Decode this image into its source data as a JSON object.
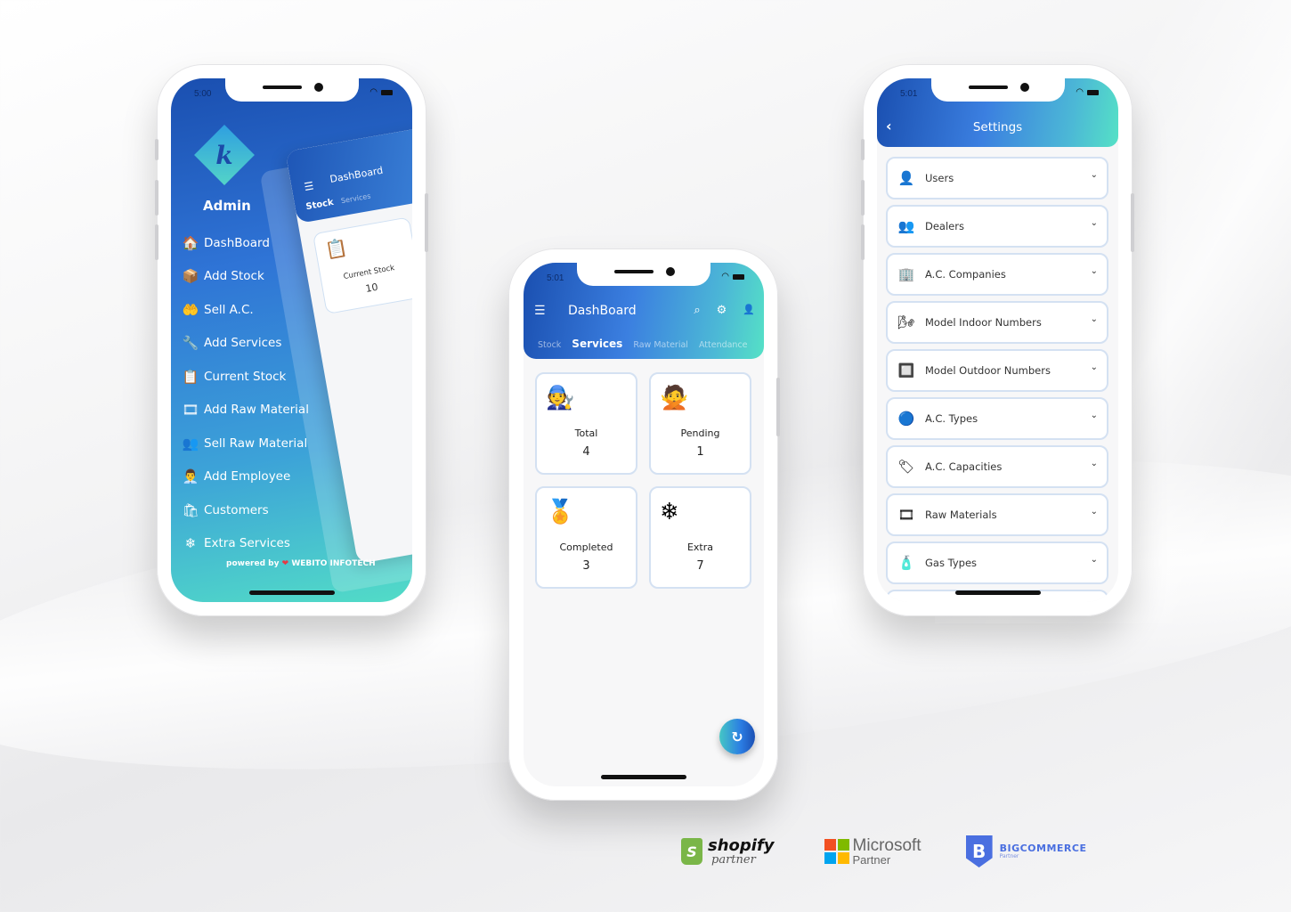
{
  "phone_admin": {
    "status_time": "5:00",
    "logo_letter": "k",
    "user_name": "Admin",
    "menu": [
      {
        "label": "DashBoard",
        "icon": "🏠"
      },
      {
        "label": "Add Stock",
        "icon": "📦"
      },
      {
        "label": "Sell A.C.",
        "icon": "🤲"
      },
      {
        "label": "Add Services",
        "icon": "🔧"
      },
      {
        "label": "Current Stock",
        "icon": "📋"
      },
      {
        "label": "Add Raw Material",
        "icon": "🎞"
      },
      {
        "label": "Sell Raw Material",
        "icon": "👥"
      },
      {
        "label": "Add Employee",
        "icon": "👨‍💼"
      },
      {
        "label": "Customers",
        "icon": "🛍"
      },
      {
        "label": "Extra Services",
        "icon": "❄"
      }
    ],
    "powered_by_prefix": "powered by",
    "powered_by_heart": "❤",
    "powered_by_company": "WEBITO INFOTECH",
    "peek": {
      "title": "DashBoard",
      "tab_active": "Stock",
      "tab_inactive": "Services",
      "card_label": "Current Stock",
      "card_value": "10",
      "card_icon": "📋"
    }
  },
  "phone_dashboard": {
    "status_time": "5:01",
    "title": "DashBoard",
    "menu_icon": "☰",
    "search_icon": "⌕",
    "gear_icon": "⚙",
    "user_icon": "👤",
    "tabs": [
      {
        "label": "Stock",
        "active": false
      },
      {
        "label": "Services",
        "active": true
      },
      {
        "label": "Raw Material",
        "active": false
      },
      {
        "label": "Attendance",
        "active": false
      }
    ],
    "cards": [
      {
        "label": "Total",
        "value": "4",
        "icon": "🧑‍🔧"
      },
      {
        "label": "Pending",
        "value": "1",
        "icon": "🙅"
      },
      {
        "label": "Completed",
        "value": "3",
        "icon": "🏅"
      },
      {
        "label": "Extra",
        "value": "7",
        "icon": "❄"
      }
    ],
    "refresh_icon": "↻"
  },
  "phone_settings": {
    "status_time": "5:01",
    "back_icon": "‹",
    "title": "Settings",
    "items": [
      {
        "label": "Users",
        "icon": "👤"
      },
      {
        "label": "Dealers",
        "icon": "👥"
      },
      {
        "label": "A.C. Companies",
        "icon": "🏢"
      },
      {
        "label": "Model Indoor Numbers",
        "icon": "🌬"
      },
      {
        "label": "Model Outdoor Numbers",
        "icon": "🔲"
      },
      {
        "label": "A.C. Types",
        "icon": "🔵"
      },
      {
        "label": "A.C. Capacities",
        "icon": "🏷"
      },
      {
        "label": "Raw Materials",
        "icon": "🎞"
      },
      {
        "label": "Gas Types",
        "icon": "🧴"
      }
    ],
    "chevron_icon": "⌄"
  },
  "partners": {
    "shopify": {
      "name": "shopify",
      "sub": "partner",
      "mark": "S"
    },
    "microsoft": {
      "name": "Microsoft",
      "sub": "Partner",
      "colors": [
        "#f25022",
        "#7fba00",
        "#00a4ef",
        "#ffb900"
      ]
    },
    "bigcommerce": {
      "name": "BIGCOMMERCE",
      "sub": "Partner",
      "mark": "B"
    }
  }
}
